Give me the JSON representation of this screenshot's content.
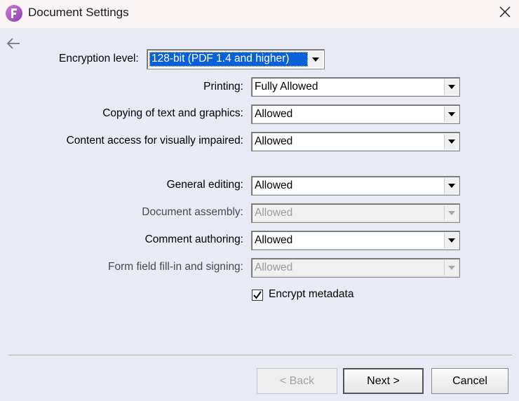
{
  "window": {
    "title": "Document Settings",
    "app_icon": "foxit-logo-icon",
    "close_icon": "close-icon",
    "back_icon": "back-arrow-icon"
  },
  "form": {
    "encryption": {
      "label": "Encryption level:",
      "value": "128-bit (PDF 1.4 and higher)",
      "selected_highlight": "#0a60d6"
    },
    "permissions": [
      {
        "label": "Printing:",
        "value": "Fully Allowed",
        "enabled": true
      },
      {
        "label": "Copying of text and graphics:",
        "value": "Allowed",
        "enabled": true
      },
      {
        "label": "Content access for visually impaired:",
        "value": "Allowed",
        "enabled": true
      },
      {
        "label": "General editing:",
        "value": "Allowed",
        "enabled": true
      },
      {
        "label": "Document assembly:",
        "value": "Allowed",
        "enabled": false
      },
      {
        "label": "Comment authoring:",
        "value": "Allowed",
        "enabled": true
      },
      {
        "label": "Form field fill-in and signing:",
        "value": "Allowed",
        "enabled": false
      }
    ],
    "encrypt_metadata": {
      "label": "Encrypt metadata",
      "checked": true
    }
  },
  "footer": {
    "back_label": "< Back",
    "next_label": "Next >",
    "cancel_label": "Cancel"
  },
  "colors": {
    "titlebar_bg": "#fbf5f6",
    "body_bg": "#e8eaf6",
    "app_icon": "#b05cc8"
  }
}
